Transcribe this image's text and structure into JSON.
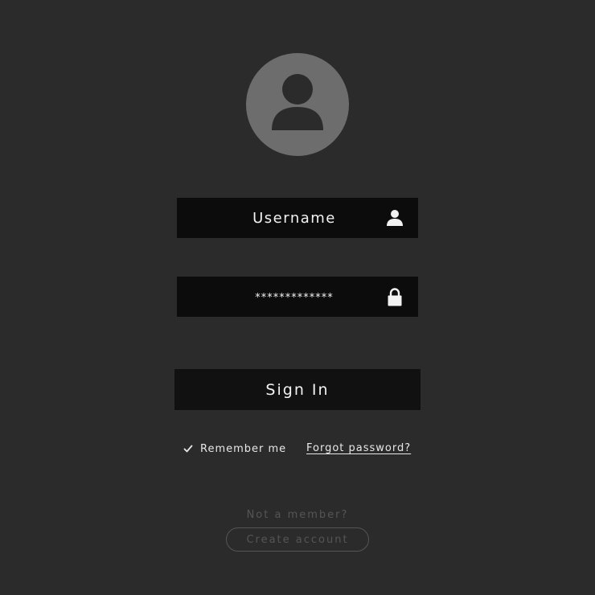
{
  "login": {
    "username_placeholder": "Username",
    "password_value": "*************",
    "signin_label": "Sign In",
    "remember_label": "Remember me",
    "remember_checked": true,
    "forgot_label": "Forgot password?",
    "not_member_text": "Not a member?",
    "create_account_label": "Create account"
  },
  "icons": {
    "avatar": "user-avatar-icon",
    "username": "user-icon",
    "password": "lock-icon",
    "remember": "checkmark-icon"
  },
  "colors": {
    "background": "#2b2b2b",
    "field": "#0c0c0c",
    "button": "#111111",
    "avatar_circle": "#6d6d6d",
    "avatar_figure": "#2b2b2b",
    "text": "#f2f2f2",
    "muted": "#555555"
  }
}
